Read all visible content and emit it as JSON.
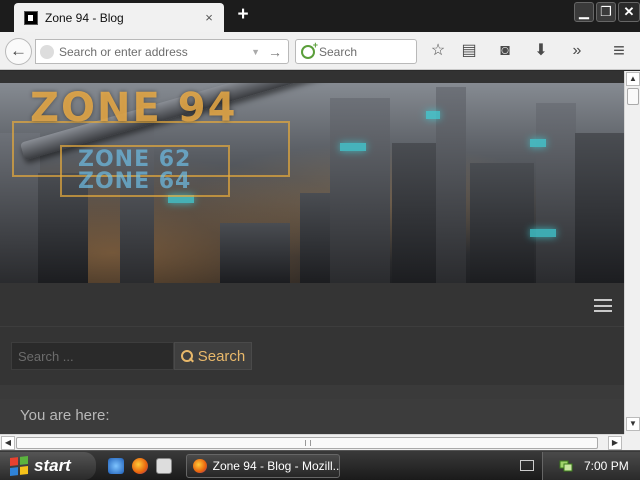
{
  "browser": {
    "tab": {
      "title": "Zone 94 - Blog",
      "close_icon": "×"
    },
    "new_tab_icon": "+",
    "window_controls": {
      "minimize": "▁",
      "restore": "❐",
      "close": "✕"
    },
    "back_icon": "←",
    "address": {
      "value": "",
      "placeholder": "Search or enter address"
    },
    "search": {
      "value": "",
      "placeholder": "Search"
    },
    "toolbar_icons": {
      "bookmark_star": "☆",
      "reader_list": "▤",
      "pocket": "◙",
      "downloads": "⬇",
      "overflow": "»",
      "menu": "≡"
    }
  },
  "page": {
    "logo": {
      "title": "ZONE 94",
      "line1": "ZONE 62",
      "line2": "ZONE 64"
    },
    "site_search": {
      "placeholder": "Search ...",
      "button_label": "Search"
    },
    "breadcrumb_label": "You are here:"
  },
  "taskbar": {
    "start_label": "start",
    "task_item_label": "Zone 94 - Blog - Mozill...",
    "clock": "7:00 PM"
  },
  "colors": {
    "accent_gold": "#e8b86a",
    "logo_gold": "#f0af46",
    "page_bg": "#343434"
  }
}
